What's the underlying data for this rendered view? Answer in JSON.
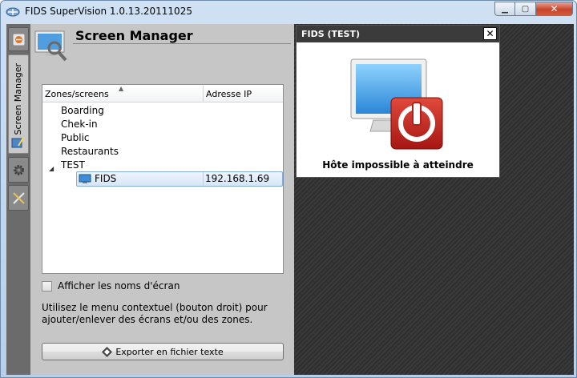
{
  "window": {
    "title": "FIDS SuperVision 1.0.13.20111025",
    "minimize_label": "▁",
    "maximize_label": "▢",
    "close_label": "✕"
  },
  "side_toolbar": {
    "tab_label": "Screen Manager"
  },
  "panel": {
    "title": "Screen Manager",
    "columns": {
      "zone": "Zones/screens",
      "ip": "Adresse IP"
    },
    "tree": [
      {
        "label": "Boarding"
      },
      {
        "label": "Chek-in"
      },
      {
        "label": "Public"
      },
      {
        "label": "Restaurants"
      },
      {
        "label": "TEST"
      }
    ],
    "selected": {
      "name": "FIDS",
      "ip": "192.168.1.69"
    },
    "checkbox_label": "Afficher les noms d'écran",
    "help_line1": "Utilisez le menu contextuel (bouton droit) pour",
    "help_line2": "ajouter/enlever des écrans et/ou des zones.",
    "export_label": "Exporter en fichier texte"
  },
  "popup": {
    "title": "FIDS (TEST)",
    "close_label": "✕",
    "message": "Hôte impossible à atteindre"
  },
  "colors": {
    "popup_header": "#3b3b3b",
    "power_red": "#c4201b",
    "selection_border": "#84acdd"
  }
}
